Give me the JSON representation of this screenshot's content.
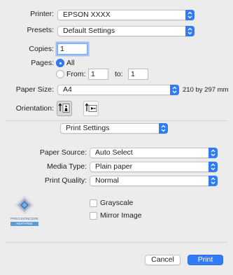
{
  "colors": {
    "accent": "#2f7cf6",
    "background": "#ececec"
  },
  "printer": {
    "label": "Printer:",
    "value": "EPSON XXXX"
  },
  "presets": {
    "label": "Presets:",
    "value": "Default Settings"
  },
  "copies": {
    "label": "Copies:",
    "value": "1"
  },
  "pages": {
    "label": "Pages:",
    "all_label": "All",
    "all_selected": true,
    "from_label": "From:",
    "from_value": "1",
    "to_label": "to:",
    "to_value": "1"
  },
  "paper_size": {
    "label": "Paper Size:",
    "value": "A4",
    "dimensions": "210 by 297 mm"
  },
  "orientation": {
    "label": "Orientation:",
    "selected": "portrait",
    "options": [
      "portrait-icon",
      "landscape-icon"
    ]
  },
  "section_menu": {
    "value": "Print Settings"
  },
  "print_settings": {
    "paper_source": {
      "label": "Paper Source:",
      "value": "Auto Select"
    },
    "media_type": {
      "label": "Media Type:",
      "value": "Plain paper"
    },
    "print_quality": {
      "label": "Print Quality:",
      "value": "Normal"
    },
    "logo": {
      "line1": "PRECISIONCORE",
      "line2": "HEAT-FREE"
    },
    "grayscale": {
      "label": "Grayscale",
      "checked": false
    },
    "mirror_image": {
      "label": "Mirror Image",
      "checked": false
    }
  },
  "footer": {
    "cancel_label": "Cancel",
    "print_label": "Print"
  }
}
